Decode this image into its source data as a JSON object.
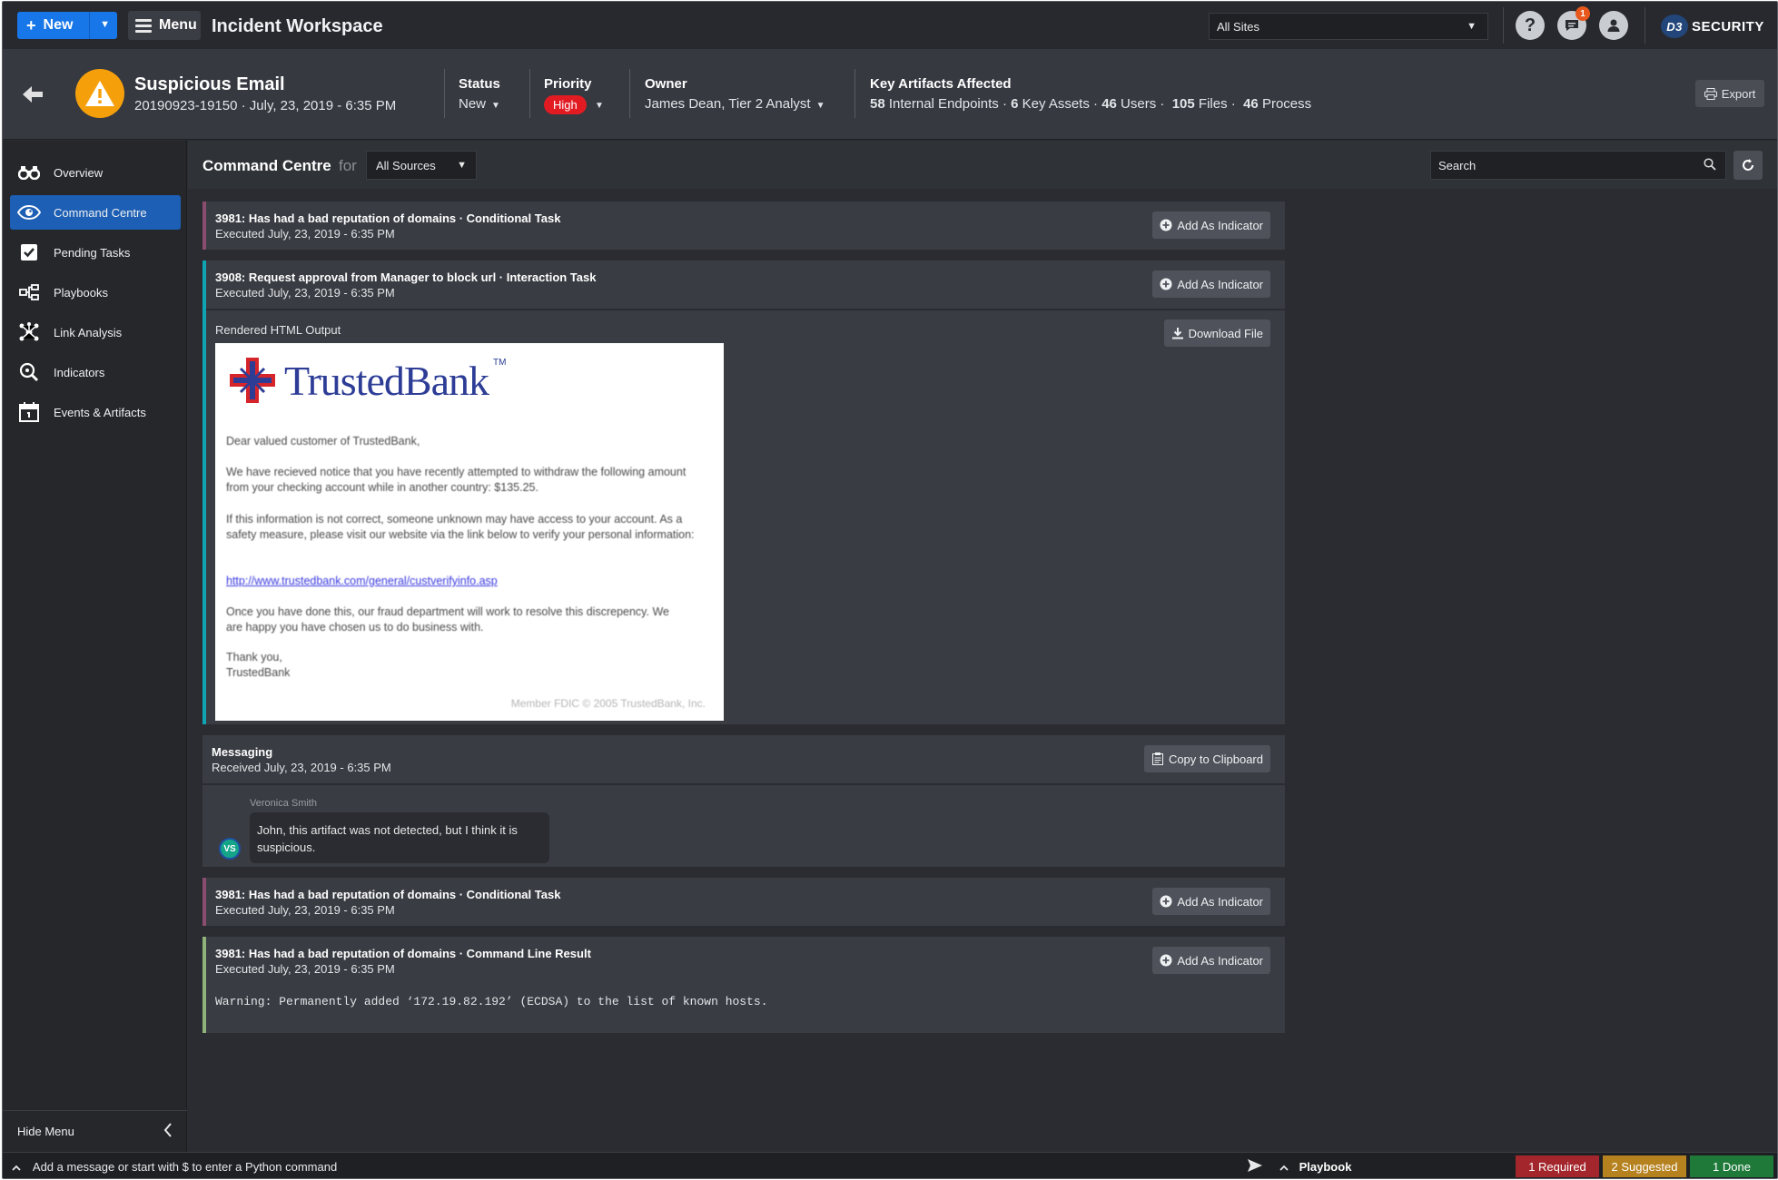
{
  "topbar": {
    "new_label": "New",
    "menu_label": "Menu",
    "app_title": "Incident Workspace",
    "site_select_value": "All Sites",
    "notification_count": "1",
    "logo_mark": "D3",
    "logo_text": "SECURITY"
  },
  "incident": {
    "title": "Suspicious Email",
    "subtitle": "20190923-19150 · July, 23, 2019 - 6:35 PM",
    "status_label": "Status",
    "status_value": "New",
    "priority_label": "Priority",
    "priority_value": "High",
    "owner_label": "Owner",
    "owner_value": "James Dean, Tier 2 Analyst",
    "artifacts_label": "Key Artifacts Affected",
    "artifacts": [
      {
        "count": "58",
        "name": "Internal Endpoints"
      },
      {
        "count": "6",
        "name": "Key Assets"
      },
      {
        "count": "46",
        "name": "Users"
      },
      {
        "count": "105",
        "name": "Files"
      },
      {
        "count": "46",
        "name": "Process"
      }
    ],
    "export_label": "Export",
    "priority_color": "#e21b23"
  },
  "sidebar": {
    "items": [
      {
        "label": "Overview",
        "icon": "binoculars-icon"
      },
      {
        "label": "Command Centre",
        "icon": "eye-icon"
      },
      {
        "label": "Pending Tasks",
        "icon": "checkbox-icon"
      },
      {
        "label": "Playbooks",
        "icon": "flow-icon"
      },
      {
        "label": "Link Analysis",
        "icon": "network-icon"
      },
      {
        "label": "Indicators",
        "icon": "magnifier-icon"
      },
      {
        "label": "Events & Artifacts",
        "icon": "calendar-icon"
      }
    ],
    "hide_menu_label": "Hide Menu"
  },
  "toolbar": {
    "title": "Command Centre",
    "for_text": "for",
    "source_value": "All Sources",
    "search_placeholder": "Search"
  },
  "cards": [
    {
      "title": "3981: Has had a bad reputation of domains · Conditional Task",
      "time": "Executed July, 23, 2019 - 6:35 PM",
      "button": "Add As Indicator"
    },
    {
      "title": "3908: Request approval from Manager to block url · Interaction Task",
      "time": "Executed July, 23, 2019 - 6:35 PM",
      "button": "Add As Indicator",
      "output_label": "Rendered HTML Output",
      "download_label": "Download File"
    },
    {
      "title": "Messaging",
      "time": "Received July, 23, 2019 - 6:35 PM",
      "button": "Copy to Clipboard"
    },
    {
      "title": "3981: Has had a bad reputation of domains · Conditional Task",
      "time": "Executed July, 23, 2019 - 6:35 PM",
      "button": "Add As Indicator"
    },
    {
      "title": "3981: Has had a bad reputation of domains · Command Line Result",
      "time": "Executed July, 23, 2019 - 6:35 PM",
      "button": "Add As Indicator",
      "output": "Warning: Permanently added ‘172.19.82.192’ (ECDSA) to the list of known hosts."
    }
  ],
  "email": {
    "brand": "TrustedBank",
    "tm": "TM",
    "greeting": "Dear valued customer of TrustedBank,",
    "para1": "We have recieved notice that you have recently attempted to withdraw the following amount from your checking account while in another country: $135.25.",
    "para2": "If this information is not correct, someone unknown may have access to your account. As a safety measure, please visit our website via the link below to verify your personal information:",
    "link": "http://www.trustedbank.com/general/custverifyinfo.asp",
    "para3": "Once you have done this, our fraud department will work to resolve this discrepency. We are happy you have chosen us to do business with.",
    "signoff1": "Thank you,",
    "signoff2": "TrustedBank",
    "footer": "Member FDIC © 2005 TrustedBank, Inc."
  },
  "message": {
    "author": "Veronica Smith",
    "initials": "VS",
    "text": "John, this artifact was not detected, but I think it is suspicious."
  },
  "bottombar": {
    "command_placeholder": "Add a message or start with $ to enter a Python command",
    "playbook_label": "Playbook",
    "required": "1 Required",
    "suggested": "2 Suggested",
    "done": "1 Done",
    "required_color": "#a3262c",
    "suggested_color": "#b6811f",
    "done_color": "#1f7a3a"
  }
}
